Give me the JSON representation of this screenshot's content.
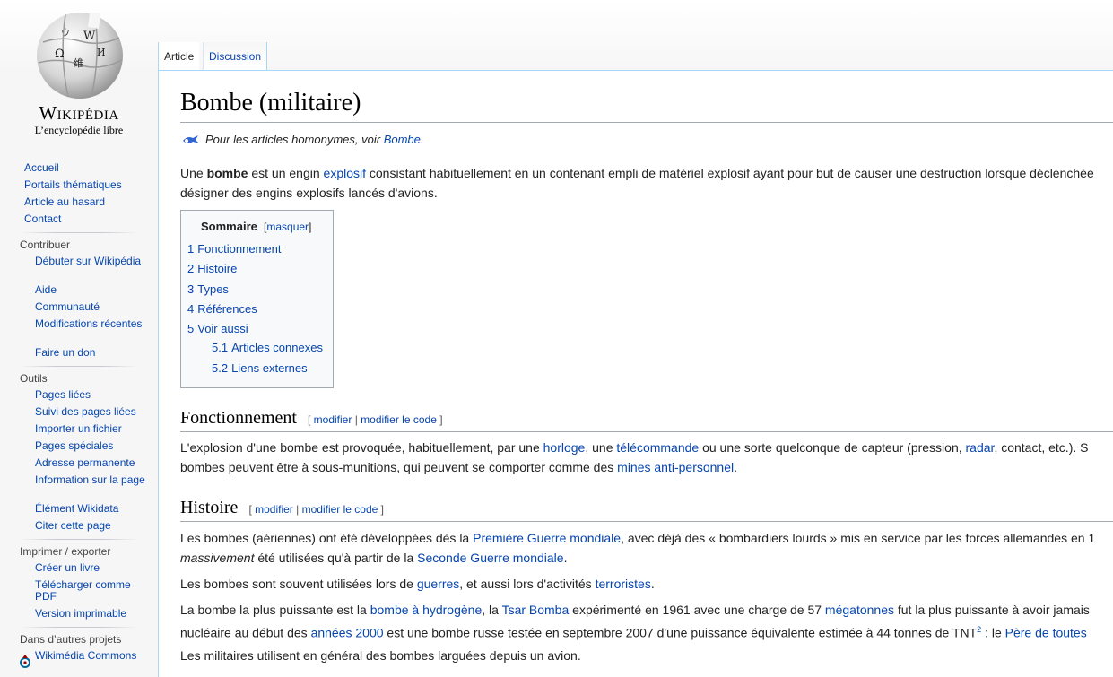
{
  "logo": {
    "wordmark": "Wikipédia",
    "tagline": "L’encyclopédie libre"
  },
  "nav_main": [
    "Accueil",
    "Portails thématiques",
    "Article au hasard",
    "Contact"
  ],
  "portals": [
    {
      "title": "Contribuer",
      "items": [
        "Débuter sur Wikipédia",
        "Aide",
        "Communauté",
        "Modifications récentes",
        "Faire un don"
      ]
    },
    {
      "title": "Outils",
      "items": [
        "Pages liées",
        "Suivi des pages liées",
        "Importer un fichier",
        "Pages spéciales",
        "Adresse permanente",
        "Information sur la page",
        "Élément Wikidata",
        "Citer cette page"
      ]
    },
    {
      "title": "Imprimer / exporter",
      "items": [
        "Créer un livre",
        "Télécharger comme PDF",
        "Version imprimable"
      ]
    },
    {
      "title": "Dans d’autres projets",
      "items": [
        "Wikimédia Commons"
      ]
    }
  ],
  "tabs": {
    "article": "Article",
    "discussion": "Discussion"
  },
  "heading": "Bombe (militaire)",
  "hatnote": {
    "prefix": "Pour les articles homonymes, voir ",
    "link": "Bombe",
    "suffix": "."
  },
  "intro": {
    "l1a": "Une ",
    "l1b": "bombe",
    "l1c": " est un engin ",
    "l1link": "explosif",
    "l1d": " consistant habituellement en un contenant empli de matériel explosif ayant pour but de causer une destruction lorsque déclenchée",
    "l2": "désigner des engins explosifs lancés d'avions."
  },
  "toc": {
    "title": "Sommaire",
    "toggle_open": "[",
    "toggle_link": "masquer",
    "toggle_close": "]",
    "entries": [
      {
        "num": "1",
        "label": "Fonctionnement"
      },
      {
        "num": "2",
        "label": "Histoire"
      },
      {
        "num": "3",
        "label": "Types"
      },
      {
        "num": "4",
        "label": "Références"
      },
      {
        "num": "5",
        "label": "Voir aussi"
      },
      {
        "num": "5.1",
        "label": "Articles connexes"
      },
      {
        "num": "5.2",
        "label": "Liens externes"
      }
    ]
  },
  "editsec": {
    "open": "[",
    "edit": "modifier",
    "sep": " | ",
    "edit_code": "modifier le code",
    "close": "]"
  },
  "section1": {
    "title": "Fonctionnement",
    "p1": {
      "a": "L'explosion d'une bombe est provoquée, habituellement, par une ",
      "l1": "horloge",
      "b": ", une ",
      "l2": "télécommande",
      "c": " ou une sorte quelconque de capteur (pression, ",
      "l3": "radar",
      "d": ", contact, etc.). S"
    },
    "p2": {
      "a": "bombes peuvent être à sous-munitions, qui peuvent se comporter comme des ",
      "l1": "mines anti-personnel",
      "b": "."
    }
  },
  "section2": {
    "title": "Histoire",
    "p1": {
      "a": "Les bombes (aériennes) ont été développées dès la ",
      "l1": "Première Guerre mondiale",
      "b": ", avec déjà des « bombardiers lourds » mis en service par les forces allemandes en 1"
    },
    "p1b": {
      "a": "massivement",
      "b": " été utilisées qu'à partir de la ",
      "l1": "Seconde Guerre mondiale",
      "c": "."
    },
    "p2": {
      "a": "Les bombes sont souvent utilisées lors de ",
      "l1": "guerres",
      "b": ", et aussi lors d'activités ",
      "l2": "terroristes",
      "c": "."
    },
    "p3": {
      "a": "La bombe la plus puissante est la ",
      "l1": "bombe à hydrogène",
      "b": ", la ",
      "l2": "Tsar Bomba",
      "c": " expérimenté en 1961 avec une charge de 57 ",
      "l3": "mégatonnes",
      "d": " fut la plus puissante à avoir jamais"
    },
    "p3b": {
      "a": "nucléaire au début des ",
      "l1": "années 2000",
      "b": " est une bombe russe testée en septembre 2007 d'une puissance équivalente estimée à 44 tonnes de TNT",
      "sup": "2",
      "c": " : le ",
      "l2": "Père de toutes"
    },
    "p4": "Les militaires utilisent en général des bombes larguées depuis un avion."
  }
}
